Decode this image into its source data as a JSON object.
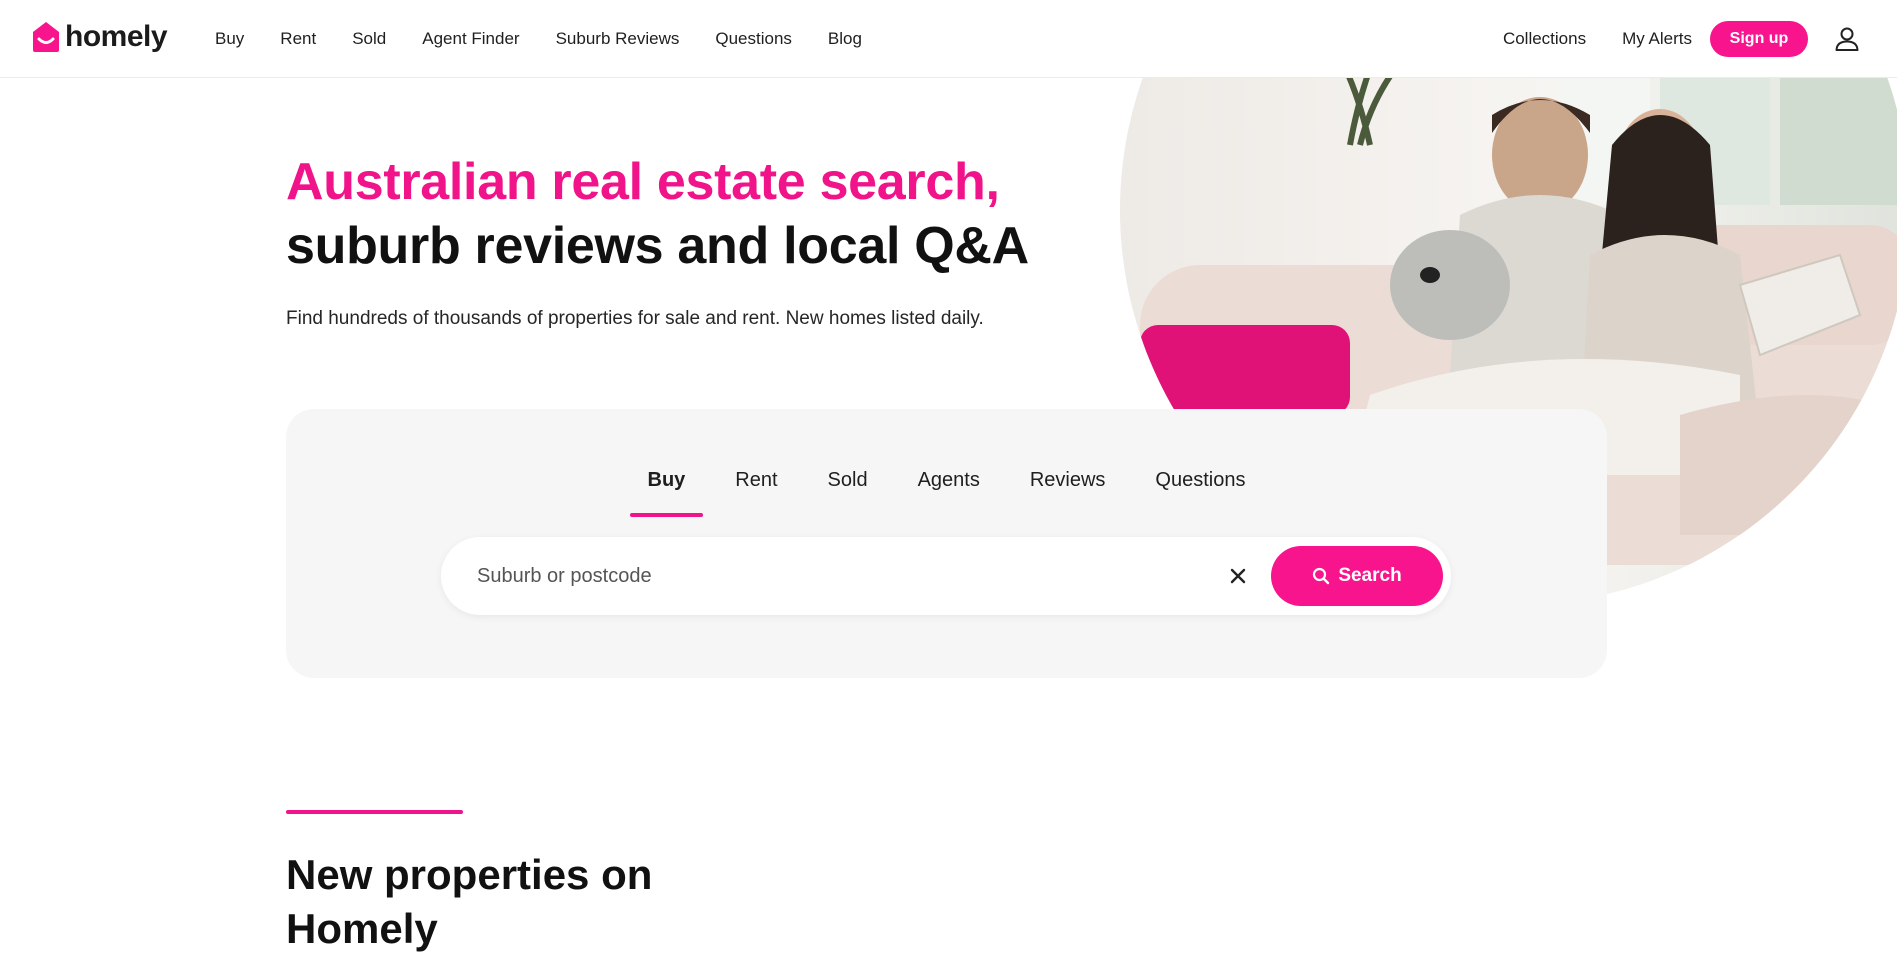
{
  "brand": {
    "name": "homely",
    "accent": "#f7148c"
  },
  "nav": {
    "items": [
      {
        "label": "Buy"
      },
      {
        "label": "Rent"
      },
      {
        "label": "Sold"
      },
      {
        "label": "Agent Finder"
      },
      {
        "label": "Suburb Reviews"
      },
      {
        "label": "Questions"
      },
      {
        "label": "Blog"
      }
    ],
    "right": {
      "collections": "Collections",
      "alerts": "My Alerts",
      "signup": "Sign up"
    }
  },
  "hero": {
    "headline_pink": "Australian real estate search,",
    "headline_dark": "suburb reviews and local Q&A",
    "subhead": "Find hundreds of thousands of properties for sale and rent. New homes listed daily."
  },
  "search": {
    "tabs": [
      {
        "label": "Buy",
        "active": true
      },
      {
        "label": "Rent",
        "active": false
      },
      {
        "label": "Sold",
        "active": false
      },
      {
        "label": "Agents",
        "active": false
      },
      {
        "label": "Reviews",
        "active": false
      },
      {
        "label": "Questions",
        "active": false
      }
    ],
    "placeholder": "Suburb or postcode",
    "value": "",
    "button_label": "Search"
  },
  "section": {
    "title": "New properties on Homely"
  },
  "icons": {
    "logo": "house-logo-icon",
    "user": "user-icon",
    "clear": "close-icon",
    "search": "search-icon"
  }
}
